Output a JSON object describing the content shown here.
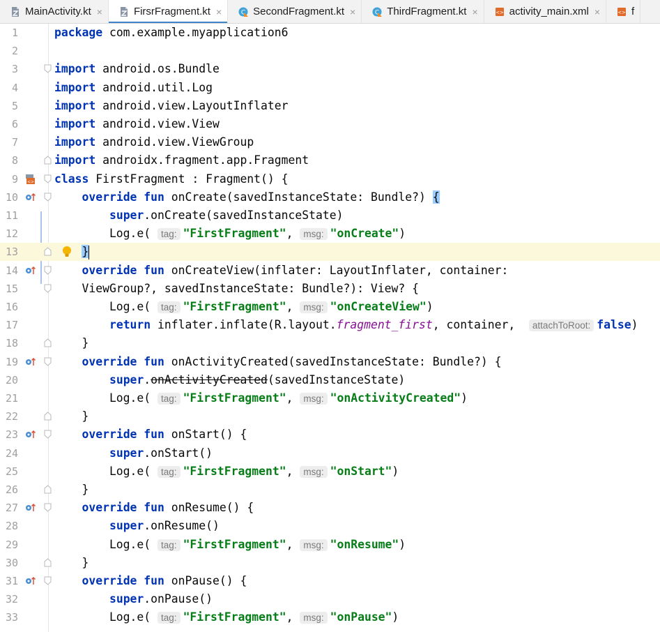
{
  "tabs": [
    {
      "label": "MainActivity.kt",
      "icon": "kotlin-file-icon",
      "active": false
    },
    {
      "label": "FirsrFragment.kt",
      "icon": "kotlin-file-icon",
      "active": true
    },
    {
      "label": "SecondFragment.kt",
      "icon": "kotlin-class-icon",
      "active": false
    },
    {
      "label": "ThirdFragment.kt",
      "icon": "kotlin-class-icon",
      "active": false
    },
    {
      "label": "activity_main.xml",
      "icon": "xml-layout-icon",
      "active": false
    },
    {
      "label": "f",
      "icon": "xml-layout-icon",
      "active": false
    }
  ],
  "colors": {
    "keyword": "#0033b3",
    "string": "#067d17",
    "current_line": "#fcf8dc",
    "line_number": "#a0a0a0"
  },
  "current_line": 13,
  "lines": [
    {
      "n": "1",
      "t": [
        [
          "kw",
          "package"
        ],
        [
          "p",
          " com.example.myapplication6"
        ]
      ]
    },
    {
      "n": "2",
      "t": []
    },
    {
      "n": "3",
      "t": [
        [
          "kw",
          "import"
        ],
        [
          "p",
          " android.os.Bundle"
        ]
      ],
      "fold": "open"
    },
    {
      "n": "4",
      "t": [
        [
          "kw",
          "import"
        ],
        [
          "p",
          " android.util.Log"
        ]
      ]
    },
    {
      "n": "5",
      "t": [
        [
          "kw",
          "import"
        ],
        [
          "p",
          " android.view.LayoutInflater"
        ]
      ]
    },
    {
      "n": "6",
      "t": [
        [
          "kw",
          "import"
        ],
        [
          "p",
          " android.view.View"
        ]
      ]
    },
    {
      "n": "7",
      "t": [
        [
          "kw",
          "import"
        ],
        [
          "p",
          " android.view.ViewGroup"
        ]
      ]
    },
    {
      "n": "8",
      "t": [
        [
          "kw",
          "import"
        ],
        [
          "p",
          " androidx.fragment.app.Fragment"
        ]
      ],
      "fold": "close"
    },
    {
      "n": "9",
      "t": [
        [
          "kw",
          "class"
        ],
        [
          "p",
          " FirstFragment : Fragment() {"
        ]
      ],
      "fold": "open",
      "mark": "layout"
    },
    {
      "n": "10",
      "t": [
        [
          "p",
          "    "
        ],
        [
          "kw",
          "override fun"
        ],
        [
          "p",
          " onCreate(savedInstanceState: Bundle?) "
        ],
        [
          "bh",
          "{"
        ]
      ],
      "fold": "open",
      "mark": "override"
    },
    {
      "n": "11",
      "t": [
        [
          "p",
          "        "
        ],
        [
          "kw",
          "super"
        ],
        [
          "p",
          ".onCreate(savedInstanceState)"
        ]
      ]
    },
    {
      "n": "12",
      "t": [
        [
          "p",
          "        Log.e( "
        ],
        [
          "h",
          "tag:"
        ],
        [
          "str",
          "\"FirstFragment\""
        ],
        [
          "p",
          ", "
        ],
        [
          "h",
          "msg:"
        ],
        [
          "str",
          "\"onCreate\""
        ],
        [
          "p",
          ")"
        ]
      ]
    },
    {
      "n": "13",
      "t": [
        [
          "p",
          "    "
        ],
        [
          "bh",
          "}"
        ],
        [
          "caret",
          ""
        ]
      ],
      "fold": "close",
      "bulb": true
    },
    {
      "n": "14",
      "t": [
        [
          "p",
          "    "
        ],
        [
          "kw",
          "override fun"
        ],
        [
          "p",
          " onCreateView(inflater: LayoutInflater, container:"
        ]
      ],
      "fold": "open",
      "mark": "override"
    },
    {
      "n": "15",
      "t": [
        [
          "p",
          "    ViewGroup?, savedInstanceState: Bundle?): View? {"
        ]
      ],
      "fold": "open"
    },
    {
      "n": "16",
      "t": [
        [
          "p",
          "        Log.e( "
        ],
        [
          "h",
          "tag:"
        ],
        [
          "str",
          "\"FirstFragment\""
        ],
        [
          "p",
          ", "
        ],
        [
          "h",
          "msg:"
        ],
        [
          "str",
          "\"onCreateView\""
        ],
        [
          "p",
          ")"
        ]
      ]
    },
    {
      "n": "17",
      "t": [
        [
          "p",
          "        "
        ],
        [
          "kw",
          "return"
        ],
        [
          "p",
          " inflater.inflate(R.layout."
        ],
        [
          "it",
          "fragment_first"
        ],
        [
          "p",
          ", container,  "
        ],
        [
          "h",
          "attachToRoot:"
        ],
        [
          "kw",
          "false"
        ],
        [
          "p",
          ")"
        ]
      ]
    },
    {
      "n": "18",
      "t": [
        [
          "p",
          "    }"
        ]
      ],
      "fold": "close"
    },
    {
      "n": "19",
      "t": [
        [
          "p",
          "    "
        ],
        [
          "kw",
          "override fun"
        ],
        [
          "p",
          " onActivityCreated(savedInstanceState: Bundle?) {"
        ]
      ],
      "fold": "open",
      "mark": "override"
    },
    {
      "n": "20",
      "t": [
        [
          "p",
          "        "
        ],
        [
          "kw",
          "super"
        ],
        [
          "p",
          "."
        ],
        [
          "st",
          "onActivityCreated"
        ],
        [
          "p",
          "(savedInstanceState)"
        ]
      ]
    },
    {
      "n": "21",
      "t": [
        [
          "p",
          "        Log.e( "
        ],
        [
          "h",
          "tag:"
        ],
        [
          "str",
          "\"FirstFragment\""
        ],
        [
          "p",
          ", "
        ],
        [
          "h",
          "msg:"
        ],
        [
          "str",
          "\"onActivityCreated\""
        ],
        [
          "p",
          ")"
        ]
      ]
    },
    {
      "n": "22",
      "t": [
        [
          "p",
          "    }"
        ]
      ],
      "fold": "close"
    },
    {
      "n": "23",
      "t": [
        [
          "p",
          "    "
        ],
        [
          "kw",
          "override fun"
        ],
        [
          "p",
          " onStart() {"
        ]
      ],
      "fold": "open",
      "mark": "override"
    },
    {
      "n": "24",
      "t": [
        [
          "p",
          "        "
        ],
        [
          "kw",
          "super"
        ],
        [
          "p",
          ".onStart()"
        ]
      ]
    },
    {
      "n": "25",
      "t": [
        [
          "p",
          "        Log.e( "
        ],
        [
          "h",
          "tag:"
        ],
        [
          "str",
          "\"FirstFragment\""
        ],
        [
          "p",
          ", "
        ],
        [
          "h",
          "msg:"
        ],
        [
          "str",
          "\"onStart\""
        ],
        [
          "p",
          ")"
        ]
      ]
    },
    {
      "n": "26",
      "t": [
        [
          "p",
          "    }"
        ]
      ],
      "fold": "close"
    },
    {
      "n": "27",
      "t": [
        [
          "p",
          "    "
        ],
        [
          "kw",
          "override fun"
        ],
        [
          "p",
          " onResume() {"
        ]
      ],
      "fold": "open",
      "mark": "override"
    },
    {
      "n": "28",
      "t": [
        [
          "p",
          "        "
        ],
        [
          "kw",
          "super"
        ],
        [
          "p",
          ".onResume()"
        ]
      ]
    },
    {
      "n": "29",
      "t": [
        [
          "p",
          "        Log.e( "
        ],
        [
          "h",
          "tag:"
        ],
        [
          "str",
          "\"FirstFragment\""
        ],
        [
          "p",
          ", "
        ],
        [
          "h",
          "msg:"
        ],
        [
          "str",
          "\"onResume\""
        ],
        [
          "p",
          ")"
        ]
      ]
    },
    {
      "n": "30",
      "t": [
        [
          "p",
          "    }"
        ]
      ],
      "fold": "close"
    },
    {
      "n": "31",
      "t": [
        [
          "p",
          "    "
        ],
        [
          "kw",
          "override fun"
        ],
        [
          "p",
          " onPause() {"
        ]
      ],
      "fold": "open",
      "mark": "override"
    },
    {
      "n": "32",
      "t": [
        [
          "p",
          "        "
        ],
        [
          "kw",
          "super"
        ],
        [
          "p",
          ".onPause()"
        ]
      ]
    },
    {
      "n": "33",
      "t": [
        [
          "p",
          "        Log.e( "
        ],
        [
          "h",
          "tag:"
        ],
        [
          "str",
          "\"FirstFragment\""
        ],
        [
          "p",
          ", "
        ],
        [
          "h",
          "msg:"
        ],
        [
          "str",
          "\"onPause\""
        ],
        [
          "p",
          ")"
        ]
      ]
    }
  ]
}
